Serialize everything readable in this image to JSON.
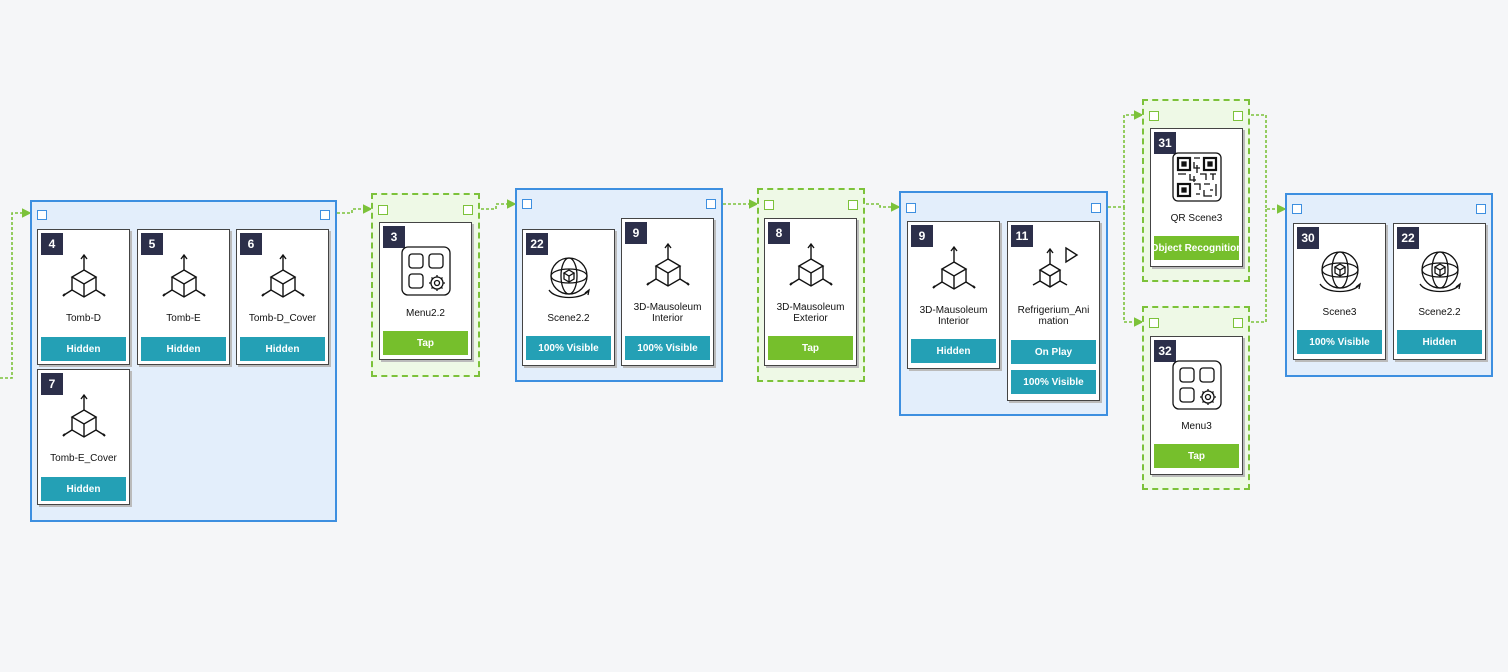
{
  "colors": {
    "blue_group_border": "#3d8fe0",
    "blue_group_fill": "#e3eefb",
    "green_group_border": "#7cc23a",
    "green_group_fill": "#eef9e6",
    "badge_teal": "#24a0b5",
    "badge_lime": "#76bf2c",
    "number_tag": "#2c2f4a",
    "link": "#7cc23a"
  },
  "nodes": [
    {
      "id": "4",
      "label": "Tomb-D",
      "icon": "3d-object-icon",
      "badges": [
        {
          "text": "Hidden",
          "tone": "teal"
        }
      ]
    },
    {
      "id": "5",
      "label": "Tomb-E",
      "icon": "3d-object-icon",
      "badges": [
        {
          "text": "Hidden",
          "tone": "teal"
        }
      ]
    },
    {
      "id": "6",
      "label": "Tomb-D_Cover",
      "icon": "3d-object-icon",
      "badges": [
        {
          "text": "Hidden",
          "tone": "teal"
        }
      ]
    },
    {
      "id": "7",
      "label": "Tomb-E_Cover",
      "icon": "3d-object-icon",
      "badges": [
        {
          "text": "Hidden",
          "tone": "teal"
        }
      ]
    },
    {
      "id": "3",
      "label": "Menu2.2",
      "icon": "menu-icon",
      "badges": [
        {
          "text": "Tap",
          "tone": "lime"
        }
      ]
    },
    {
      "id": "22",
      "label": "Scene2.2",
      "icon": "scene-icon",
      "badges": [
        {
          "text": "100% Visible",
          "tone": "teal"
        }
      ]
    },
    {
      "id": "9",
      "label": "3D-Mausoleum\nInterior",
      "icon": "3d-object-icon",
      "badges": [
        {
          "text": "100% Visible",
          "tone": "teal"
        }
      ]
    },
    {
      "id": "8",
      "label": "3D-Mausoleum\nExterior",
      "icon": "3d-object-icon",
      "badges": [
        {
          "text": "Tap",
          "tone": "lime"
        }
      ]
    },
    {
      "id": "9",
      "label": "3D-Mausoleum\nInterior",
      "icon": "3d-object-icon",
      "badges": [
        {
          "text": "Hidden",
          "tone": "teal"
        }
      ]
    },
    {
      "id": "11",
      "label": "Refrigerium_Ani\nmation",
      "icon": "animation-icon",
      "badges": [
        {
          "text": "On Play",
          "tone": "teal"
        },
        {
          "text": "100% Visible",
          "tone": "teal"
        }
      ]
    },
    {
      "id": "31",
      "label": "QR Scene3",
      "icon": "qr-code-icon",
      "badges": [
        {
          "text": "Object Recognition",
          "tone": "lime"
        }
      ]
    },
    {
      "id": "32",
      "label": "Menu3",
      "icon": "menu-icon",
      "badges": [
        {
          "text": "Tap",
          "tone": "lime"
        }
      ]
    },
    {
      "id": "30",
      "label": "Scene3",
      "icon": "scene-icon",
      "badges": [
        {
          "text": "100% Visible",
          "tone": "teal"
        }
      ]
    },
    {
      "id": "22",
      "label": "Scene2.2",
      "icon": "scene-icon",
      "badges": [
        {
          "text": "Hidden",
          "tone": "teal"
        }
      ]
    }
  ]
}
